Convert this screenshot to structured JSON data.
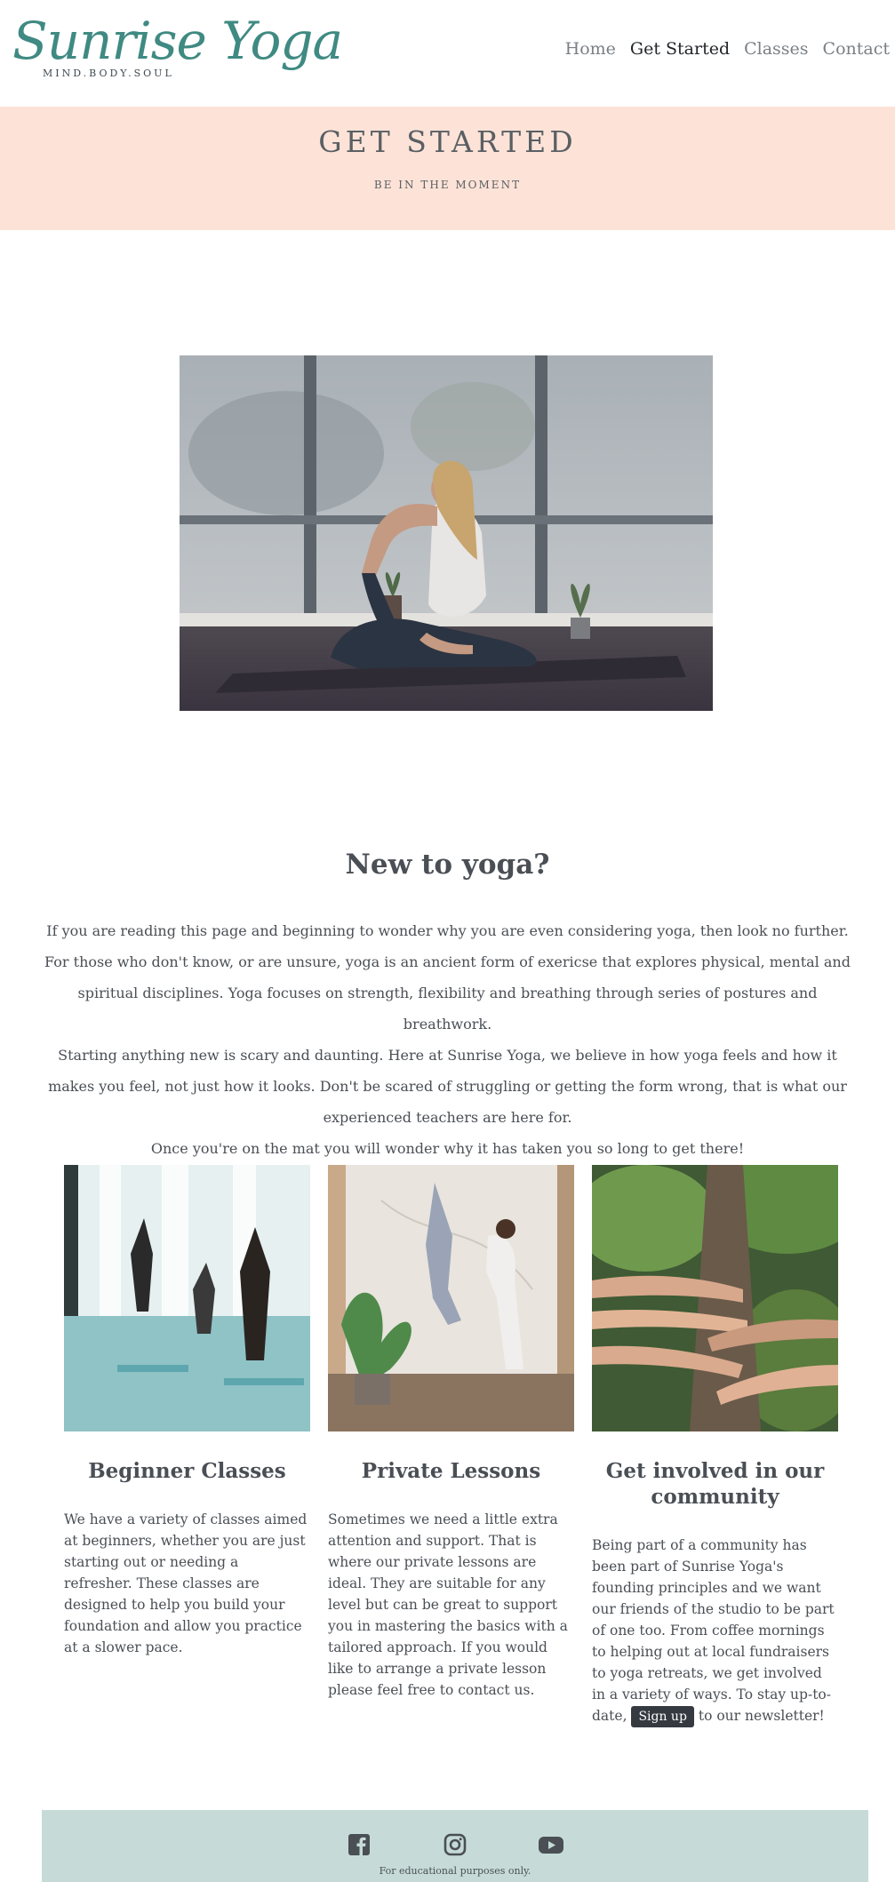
{
  "header": {
    "logo_text": "Sunrise Yoga",
    "logo_tagline": "MIND.BODY.SOUL",
    "nav": [
      {
        "label": "Home"
      },
      {
        "label": "Get Started"
      },
      {
        "label": "Classes"
      },
      {
        "label": "Contact"
      }
    ]
  },
  "banner": {
    "title": "GET STARTED",
    "subtitle": "BE IN THE MOMENT"
  },
  "intro": {
    "title": "New to yoga?",
    "lines": [
      "If you are reading this page and beginning to wonder why you are even considering yoga, then look no further.",
      "For those who don't know, or are unsure, yoga is an ancient form of exericse that explores physical, mental and spiritual disciplines. Yoga focuses on strength, flexibility and breathing through series of postures and breathwork.",
      "Starting anything new is scary and daunting. Here at Sunrise Yoga, we believe in how yoga feels and how it makes you feel, not just how it looks. Don't be scared of struggling or getting the form wrong, that is what our experienced teachers are here for.",
      "Once you're on the mat you will wonder why it has taken you so long to get there!"
    ]
  },
  "cards": [
    {
      "title": "Beginner Classes",
      "text": "We have a variety of classes aimed at beginners, whether you are just starting out or needing a refresher. These classes are designed to help you build your foundation and allow you practice at a slower pace."
    },
    {
      "title": "Private Lessons",
      "text": "Sometimes we need a little extra attention and support. That is where our private lessons are ideal. They are suitable for any level but can be great to support you in mastering the basics with a tailored approach. If you would like to arrange a private lesson please feel free to contact us."
    },
    {
      "title": "Get involved in our community",
      "text_before": "Being part of a community has been part of Sunrise Yoga's founding principles and we want our friends of the studio to be part of one too. From coffee mornings to helping out at local fundraisers to yoga retreats, we get involved in a variety of ways. To stay up-to-date,",
      "signup_label": "Sign up",
      "text_after": "to our newsletter!"
    }
  ],
  "footer": {
    "icons": [
      "facebook-icon",
      "instagram-icon",
      "youtube-icon"
    ],
    "note": "For educational purposes only."
  },
  "colors": {
    "brand_teal": "#3f8a82",
    "banner_peach": "#fde3d7",
    "footer_mint": "#c6dbd7",
    "button_dark": "#343a40"
  }
}
